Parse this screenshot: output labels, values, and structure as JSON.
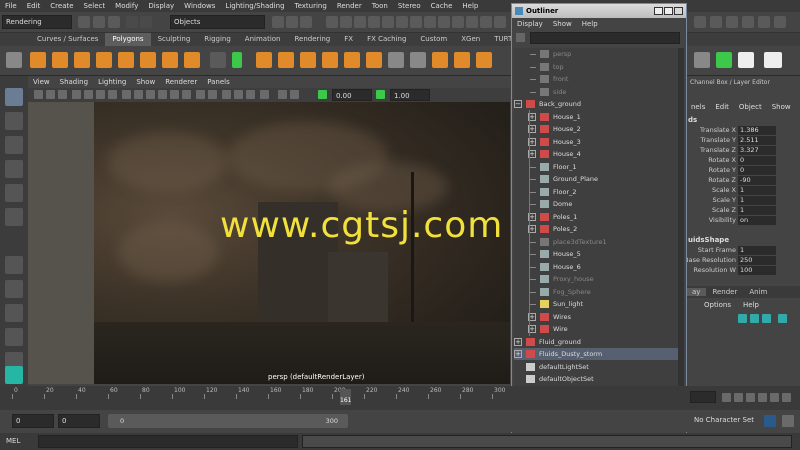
{
  "menubar": [
    "File",
    "Edit",
    "Create",
    "Select",
    "Modify",
    "Display",
    "Windows",
    "Lighting/Shading",
    "Texturing",
    "Render",
    "Toon",
    "Stereo",
    "Cache",
    "Help"
  ],
  "status": {
    "mode": "Rendering",
    "selection_mask": "Objects"
  },
  "shelf_tabs": [
    "Curves / Surfaces",
    "Polygons",
    "Sculpting",
    "Rigging",
    "Animation",
    "Rendering",
    "FX",
    "FX Caching",
    "Custom",
    "XGen",
    "TURTLE"
  ],
  "shelf_active": "Polygons",
  "viewport": {
    "menu": [
      "View",
      "Shading",
      "Lighting",
      "Show",
      "Renderer",
      "Panels"
    ],
    "field1": "0.00",
    "field2": "1.00",
    "camera_label": "persp (defaultRenderLayer)"
  },
  "watermark": "www.cgtsj.com",
  "outliner": {
    "title": "Outliner",
    "menu": [
      "Display",
      "Show",
      "Help"
    ],
    "items": [
      {
        "label": "persp",
        "indent": 1,
        "expand": false,
        "dim": true,
        "icon": "camera-icon"
      },
      {
        "label": "top",
        "indent": 1,
        "expand": false,
        "dim": true,
        "icon": "camera-icon"
      },
      {
        "label": "front",
        "indent": 1,
        "expand": false,
        "dim": true,
        "icon": "camera-icon"
      },
      {
        "label": "side",
        "indent": 1,
        "expand": false,
        "dim": true,
        "icon": "camera-icon"
      },
      {
        "label": "Back_ground",
        "indent": 0,
        "expand": "minus",
        "icon": "group-icon"
      },
      {
        "label": "House_1",
        "indent": 1,
        "expand": "plus",
        "icon": "group-icon"
      },
      {
        "label": "House_2",
        "indent": 1,
        "expand": "plus",
        "icon": "group-icon"
      },
      {
        "label": "House_3",
        "indent": 1,
        "expand": "plus",
        "icon": "group-icon"
      },
      {
        "label": "House_4",
        "indent": 1,
        "expand": "plus",
        "icon": "group-icon"
      },
      {
        "label": "Floor_1",
        "indent": 1,
        "expand": false,
        "icon": "mesh-icon"
      },
      {
        "label": "Ground_Plane",
        "indent": 1,
        "expand": false,
        "icon": "mesh-icon"
      },
      {
        "label": "Floor_2",
        "indent": 1,
        "expand": false,
        "icon": "mesh-icon"
      },
      {
        "label": "Dome",
        "indent": 1,
        "expand": false,
        "icon": "mesh-icon"
      },
      {
        "label": "Poles_1",
        "indent": 1,
        "expand": "plus",
        "icon": "group-icon"
      },
      {
        "label": "Poles_2",
        "indent": 1,
        "expand": "plus",
        "icon": "group-icon"
      },
      {
        "label": "place3dTexture1",
        "indent": 1,
        "expand": false,
        "dim": true,
        "icon": "texture-icon"
      },
      {
        "label": "House_5",
        "indent": 1,
        "expand": false,
        "icon": "mesh-icon"
      },
      {
        "label": "House_6",
        "indent": 1,
        "expand": false,
        "icon": "mesh-icon"
      },
      {
        "label": "Proxy_house",
        "indent": 1,
        "expand": false,
        "dim": true,
        "icon": "mesh-icon"
      },
      {
        "label": "Fog_Sphere",
        "indent": 1,
        "expand": false,
        "dim": true,
        "icon": "mesh-icon"
      },
      {
        "label": "Sun_light",
        "indent": 1,
        "expand": false,
        "icon": "light-icon"
      },
      {
        "label": "Wires",
        "indent": 1,
        "expand": "plus",
        "icon": "group-icon"
      },
      {
        "label": "Wire",
        "indent": 1,
        "expand": "plus",
        "icon": "group-icon"
      },
      {
        "label": "Fluid_ground",
        "indent": 0,
        "expand": "plus",
        "icon": "group-icon"
      },
      {
        "label": "Fluids_Dusty_storm",
        "indent": 0,
        "expand": "plus",
        "icon": "group-icon",
        "selected": true
      },
      {
        "label": "defaultLightSet",
        "indent": 0,
        "expand": false,
        "icon": "set-icon"
      },
      {
        "label": "defaultObjectSet",
        "indent": 0,
        "expand": false,
        "icon": "set-icon"
      }
    ]
  },
  "channel_box": {
    "header": "Channel Box / Layer Editor",
    "menu": [
      "nels",
      "Edit",
      "Object",
      "Show"
    ],
    "section1": "ds",
    "attrs": [
      {
        "label": "Translate X",
        "value": "1.386"
      },
      {
        "label": "Translate Y",
        "value": "2.511"
      },
      {
        "label": "Translate Z",
        "value": "3.327"
      },
      {
        "label": "Rotate X",
        "value": "0"
      },
      {
        "label": "Rotate Y",
        "value": "0"
      },
      {
        "label": "Rotate Z",
        "value": "-90"
      },
      {
        "label": "Scale X",
        "value": "1"
      },
      {
        "label": "Scale Y",
        "value": "1"
      },
      {
        "label": "Scale Z",
        "value": "1"
      },
      {
        "label": "Visibility",
        "value": "on"
      }
    ],
    "section2": "uidsShape",
    "attrs2": [
      {
        "label": "Start Frame",
        "value": "1"
      },
      {
        "label": "Base Resolution",
        "value": "250"
      },
      {
        "label": "Resolution W",
        "value": "100"
      }
    ],
    "layer_tabs": [
      "ay",
      "Render",
      "Anim"
    ],
    "layer_menu": [
      "",
      "Options",
      "Help"
    ]
  },
  "timeline": {
    "ticks": [
      "0",
      "20",
      "40",
      "60",
      "80",
      "100",
      "120",
      "140",
      "160",
      "180",
      "200",
      "220",
      "240",
      "260",
      "280",
      "300"
    ],
    "current": "161",
    "start": "0",
    "start2": "0",
    "range_start": "0",
    "range_end": "300",
    "character_set": "No Character Set"
  },
  "cmd_label": "MEL"
}
